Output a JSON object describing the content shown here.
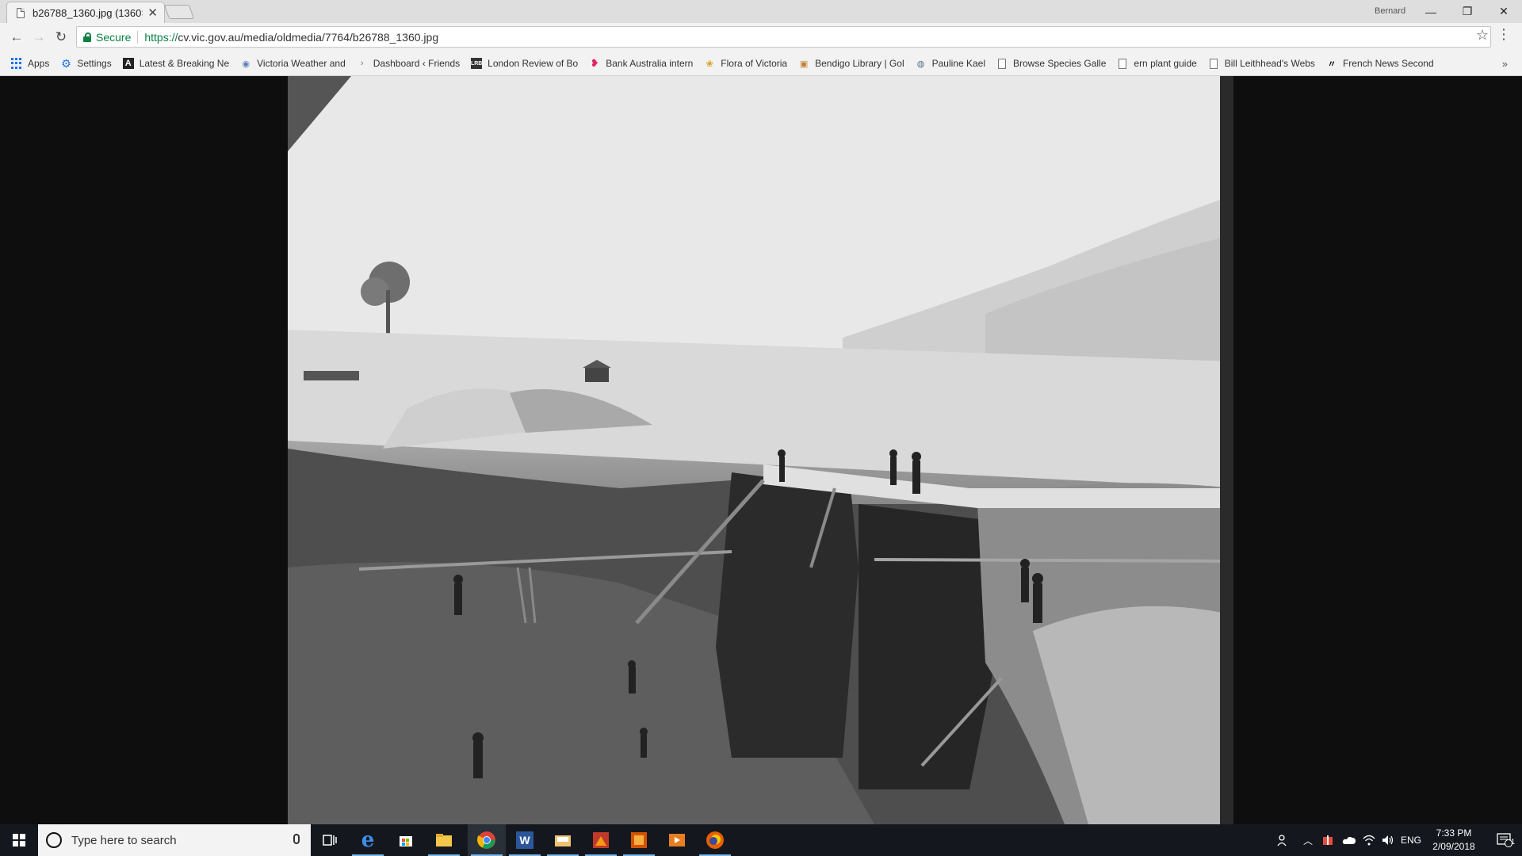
{
  "browser": {
    "tab_title": "b26788_1360.jpg (1360×",
    "tab_close": "✕",
    "profile_name": "Bernard",
    "window_controls": {
      "minimize": "—",
      "restore": "❐",
      "close": "✕"
    }
  },
  "toolbar": {
    "back": "←",
    "forward": "→",
    "reload": "↻",
    "secure_label": "Secure",
    "url_scheme": "https://",
    "url_rest": "cv.vic.gov.au/media/oldmedia/7764/b26788_1360.jpg",
    "star": "☆",
    "menu": "⋮"
  },
  "bookmarks": [
    {
      "label": "Apps",
      "icon": "apps-icon"
    },
    {
      "label": "Settings",
      "icon": "gear-icon"
    },
    {
      "label": "Latest & Breaking Ne",
      "icon": "news-icon"
    },
    {
      "label": "Victoria Weather and",
      "icon": "weather-icon"
    },
    {
      "label": "Dashboard ‹ Friends",
      "icon": "dashboard-icon"
    },
    {
      "label": "London Review of Bo",
      "icon": "lrb-icon"
    },
    {
      "label": "Bank Australia intern",
      "icon": "bank-icon"
    },
    {
      "label": "Flora of Victoria",
      "icon": "flower-icon"
    },
    {
      "label": "Bendigo Library | Gol",
      "icon": "library-icon"
    },
    {
      "label": "Pauline Kael",
      "icon": "globe-icon"
    },
    {
      "label": "Browse Species Galle",
      "icon": "page-icon"
    },
    {
      "label": "ern plant guide",
      "icon": "page-icon"
    },
    {
      "label": "Bill Leithhead's Webs",
      "icon": "page-icon"
    },
    {
      "label": "French News Second",
      "icon": "news-icon"
    }
  ],
  "bookmarks_more": "»",
  "colors": {
    "secure_green": "#0b8043",
    "taskbar": "#14181e",
    "accent": "#76b9ed"
  },
  "taskbar": {
    "search_placeholder": "Type here to search",
    "language": "ENG",
    "time": "7:33 PM",
    "date": "2/09/2018",
    "notifications_count": "1"
  }
}
